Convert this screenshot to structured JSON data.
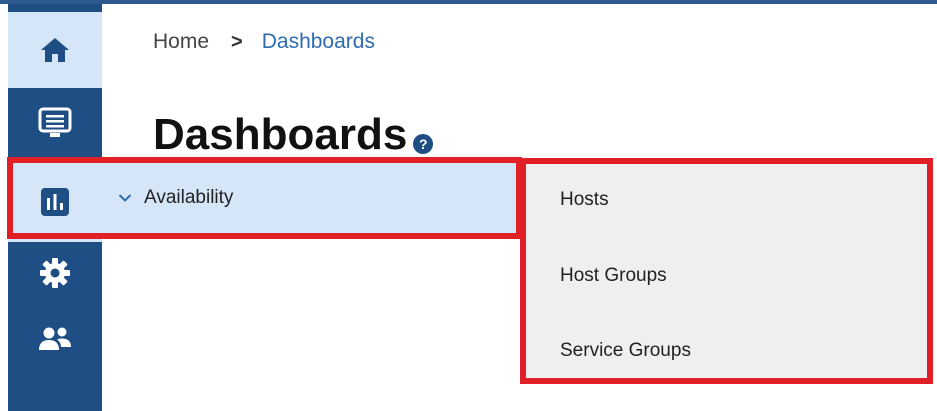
{
  "breadcrumb": {
    "home": "Home",
    "separator": ">",
    "current": "Dashboards"
  },
  "page": {
    "title": "Dashboards",
    "help": "?"
  },
  "sidebar": {
    "items": [
      {
        "name": "home",
        "icon": "home-icon",
        "active": true
      },
      {
        "name": "monitoring",
        "icon": "monitor-icon",
        "active": false
      },
      {
        "name": "dashboards",
        "icon": "bar-chart-icon",
        "active": true
      },
      {
        "name": "settings",
        "icon": "gear-icon",
        "active": false
      },
      {
        "name": "users",
        "icon": "users-icon",
        "active": false
      }
    ]
  },
  "submenu": {
    "label": "Availability",
    "icon": "chevron-down-icon"
  },
  "flyout": {
    "items": [
      "Hosts",
      "Host Groups",
      "Service Groups"
    ]
  },
  "colors": {
    "sidebar_bg": "#1f4e85",
    "active_bg": "#d4e6f7",
    "highlight": "#e01f26",
    "link": "#2f6bb0",
    "flyout_bg": "#efefef"
  }
}
